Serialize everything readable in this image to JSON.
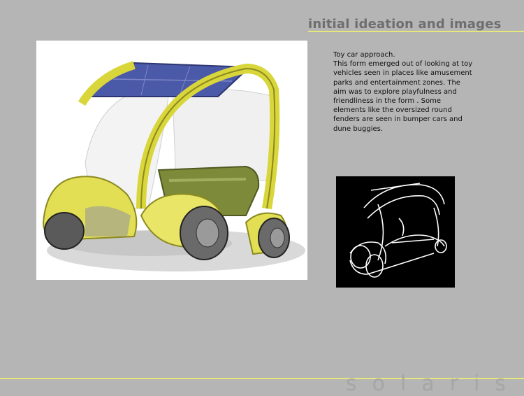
{
  "header": {
    "title": "initial ideation and images"
  },
  "description": "Toy car approach.\nThis form emerged out of looking at toy  vehicles seen in places like amusement parks and entertainment zones. The aim was to explore playfulness and friendliness in the form . Some elements like the oversized round fenders are seen in bumper cars and dune buggies.",
  "footer": {
    "brand": "solaris"
  },
  "colors": {
    "accent_line": "#e6e87a",
    "background": "#b5b5b5",
    "title": "#6e6e6e"
  }
}
